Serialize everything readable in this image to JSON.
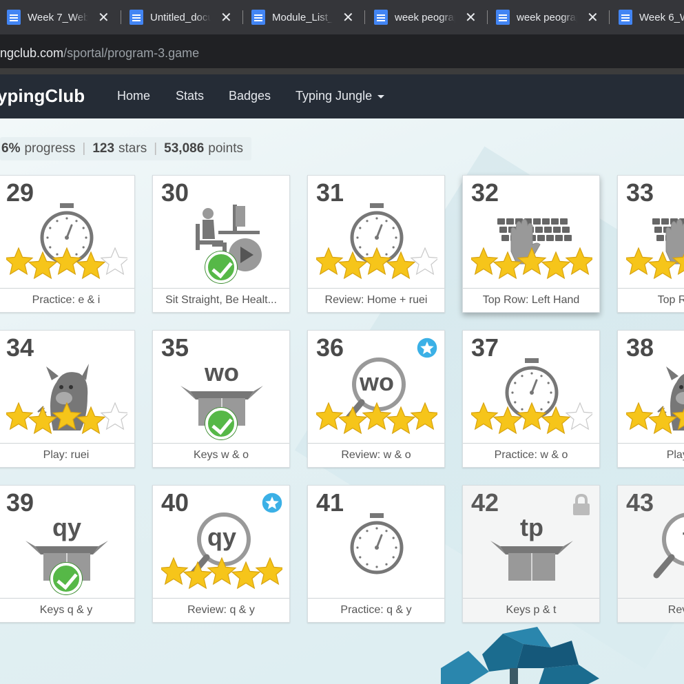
{
  "browser": {
    "tabs": [
      {
        "title": "Week 7_Web",
        "close": "✕"
      },
      {
        "title": "Untitled_docu",
        "close": "✕"
      },
      {
        "title": "Module_List_",
        "close": "✕"
      },
      {
        "title": "week peograp",
        "close": "✕"
      },
      {
        "title": "week peograp",
        "close": "✕"
      },
      {
        "title": "Week 6_W",
        "close": ""
      }
    ],
    "url_domain": "ngclub.com",
    "url_path": "/sportal/program-3.game"
  },
  "nav": {
    "brand": "ypingClub",
    "links": [
      "Home",
      "Stats",
      "Badges",
      "Typing Jungle"
    ]
  },
  "progress": {
    "pct": "6%",
    "pct_label": "progress",
    "stars": "123",
    "stars_label": "stars",
    "points": "53,086",
    "points_label": "points"
  },
  "lessons": [
    {
      "num": "29",
      "label": "Practice: e & i",
      "icon": "stopwatch-icon",
      "stars": 4
    },
    {
      "num": "30",
      "label": "Sit Straight, Be Healt...",
      "icon": "posture-video-icon",
      "stars": 0,
      "completed": true
    },
    {
      "num": "31",
      "label": "Review: Home + ruei",
      "icon": "stopwatch-icon",
      "stars": 4
    },
    {
      "num": "32",
      "label": "Top Row: Left Hand",
      "icon": "keyboard-hand-icon",
      "stars": 5
    },
    {
      "num": "33",
      "label": "Top Row: R",
      "icon": "keyboard-hand-icon",
      "stars": 5
    },
    {
      "num": "34",
      "label": "Play: ruei",
      "icon": "monster-icon",
      "stars": 4
    },
    {
      "num": "35",
      "label": "Keys w & o",
      "icon": "open-box-icon",
      "keys": "wo",
      "stars": 0,
      "completed": true
    },
    {
      "num": "36",
      "label": "Review: w & o",
      "icon": "magnifier-icon",
      "keys": "wo",
      "stars": 5,
      "badge": true
    },
    {
      "num": "37",
      "label": "Practice: w & o",
      "icon": "stopwatch-icon",
      "stars": 4
    },
    {
      "num": "38",
      "label": "Play: To",
      "icon": "monster-icon",
      "stars": 5
    },
    {
      "num": "39",
      "label": "Keys q & y",
      "icon": "open-box-icon",
      "keys": "qy",
      "stars": 0,
      "completed": true
    },
    {
      "num": "40",
      "label": "Review: q & y",
      "icon": "magnifier-icon",
      "keys": "qy",
      "stars": 5,
      "badge": true
    },
    {
      "num": "41",
      "label": "Practice: q & y",
      "icon": "stopwatch-icon",
      "stars": 0
    },
    {
      "num": "42",
      "label": "Keys p & t",
      "icon": "open-box-icon",
      "keys": "tp",
      "stars": 0,
      "locked": true
    },
    {
      "num": "43",
      "label": "Review",
      "icon": "magnifier-icon",
      "keys": "t",
      "stars": 0,
      "locked": true
    }
  ],
  "colors": {
    "star": "#f6c51a",
    "star_empty": "#ffffff",
    "check": "#56b847",
    "nav_bg": "#252c36",
    "badge": "#3bb0e6"
  }
}
